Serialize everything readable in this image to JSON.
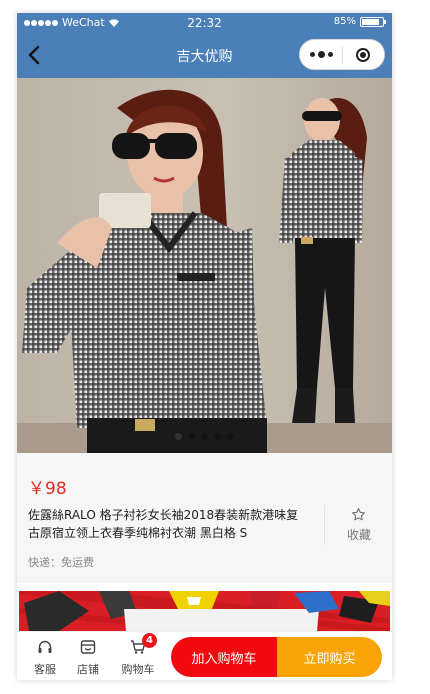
{
  "status_bar": {
    "carrier": "WeChat",
    "time": "22:32",
    "battery": "85%"
  },
  "nav": {
    "title": "吉大优购"
  },
  "product": {
    "image_count": 5,
    "active_image": 1,
    "price": "￥98",
    "title": "佐露絲RALO 格子衬衫女长袖2018春装新款港味复古原宿立领上衣春季纯棉衬衣潮 黑白格 S",
    "shipping": "快递：免运费",
    "favorite_label": "收藏"
  },
  "bottom_bar": {
    "tabs": [
      {
        "label": "客服",
        "icon": "headset-icon"
      },
      {
        "label": "店铺",
        "icon": "shop-icon"
      },
      {
        "label": "购物车",
        "icon": "cart-icon"
      }
    ],
    "cart_count": "4",
    "add_to_cart": "加入购物车",
    "buy_now": "立即购买"
  },
  "colors": {
    "nav_bg": "#4a7fb7",
    "price": "#e32b26",
    "add_to_cart_bg": "#f10a10",
    "buy_now_bg": "#fba40a"
  }
}
